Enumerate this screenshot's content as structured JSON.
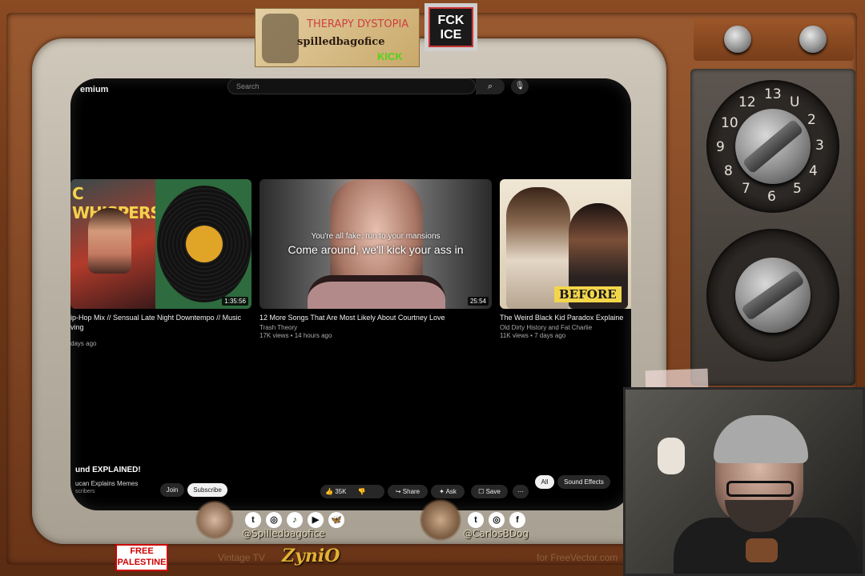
{
  "youtube": {
    "brand": "emium",
    "search_placeholder": "Search",
    "search_icon": "search-icon",
    "mic_icon": "mic-icon"
  },
  "videos": [
    {
      "title": "ip-Hop Mix // Sensual Late Night Downtempo // Music",
      "title_line2": "ving",
      "channel": "",
      "meta": "days ago",
      "duration": "1:35:56",
      "thumb_text": "C WHISPERS"
    },
    {
      "title": "12 More Songs That Are Most Likely About Courtney Love",
      "channel": "Trash Theory",
      "meta": "17K views • 14 hours ago",
      "duration": "25:54",
      "lyric_line1": "You're all fake, run to your mansions",
      "lyric_line2": "Come around, we'll kick your ass in"
    },
    {
      "title": "The Weird Black Kid Paradox Explaine",
      "channel": "Old Dirty History and Fat Charlie",
      "meta": "11K views • 7 days ago",
      "thumb_text": "BEFORE"
    }
  ],
  "player_bar": {
    "video_title": "und EXPLAINED!",
    "channel_name": "ucan Explains Memes",
    "subscribers": "scribers",
    "join": "Join",
    "subscribe": "Subscribe",
    "likes": "35K",
    "share": "Share",
    "ask": "Ask",
    "save": "Save",
    "chips": [
      "All",
      "Sound Effects"
    ]
  },
  "overlay": {
    "sticker_line1": "THERAPY DYSTOPIA",
    "sticker_line2": "spilledbagofice",
    "sticker_kick": "KICK",
    "fck_ice": "FCK ICE",
    "handle_left": "@Spilledbagofice",
    "handle_right": "@CarlosBDog",
    "free_palestine_1": "FREE",
    "free_palestine_2": "PALESTINE",
    "brand": "ZyniO",
    "vintage": "Vintage TV",
    "credit": "for FreeVector.com"
  },
  "tv_dial_numbers": [
    "12",
    "13",
    "U",
    "2",
    "3",
    "4",
    "5",
    "6",
    "7",
    "8",
    "9",
    "10",
    "11"
  ],
  "social_icons": [
    "twitter-icon",
    "instagram-icon",
    "tiktok-icon",
    "youtube-icon",
    "bluesky-icon",
    "twitter-icon",
    "instagram-icon",
    "facebook-icon"
  ]
}
